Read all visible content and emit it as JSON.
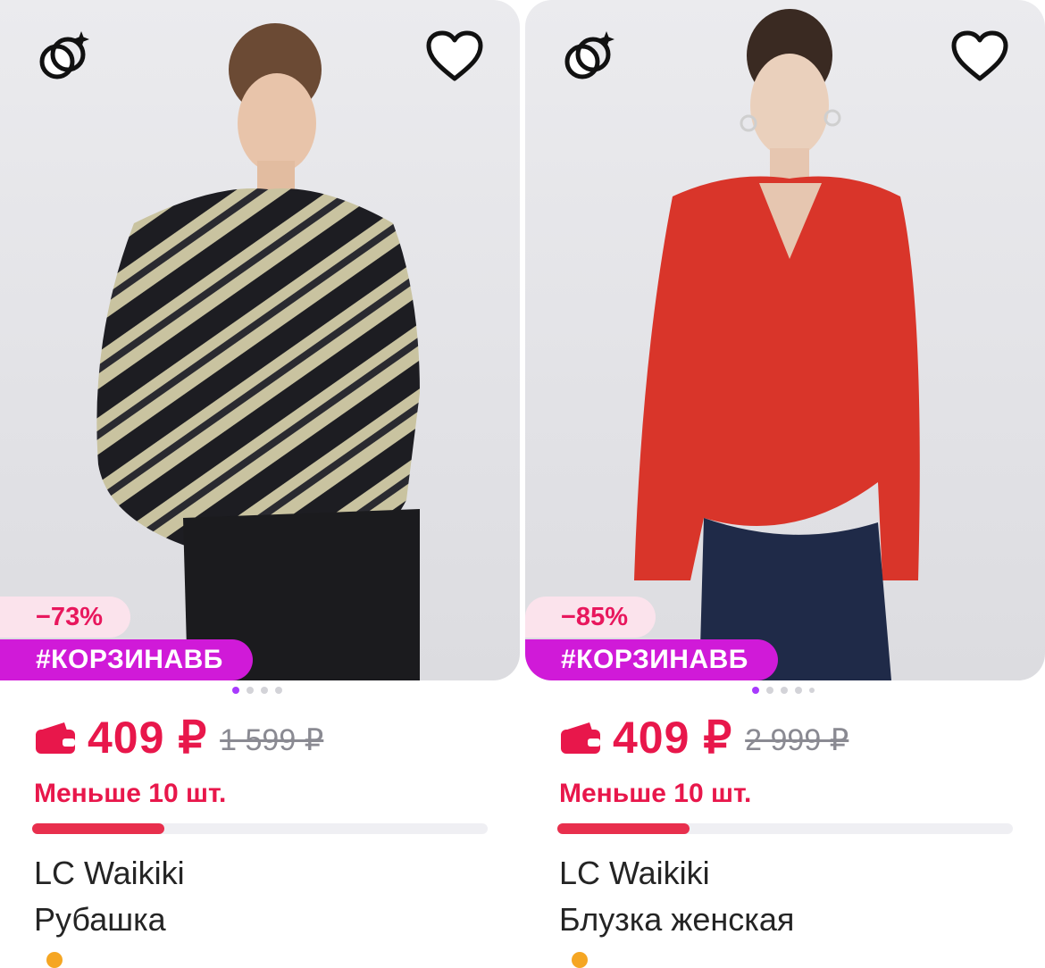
{
  "products": [
    {
      "discount": "−73%",
      "promo_tag": "#КОРЗИНАВБ",
      "price": "409 ₽",
      "old_price": "1 599 ₽",
      "stock_text": "Меньше 10 шт.",
      "stock_level_fraction": 0.29,
      "brand": "LC Waikiki",
      "title": "Рубашка",
      "photo_slides": 4,
      "active_slide": 1
    },
    {
      "discount": "−85%",
      "promo_tag": "#КОРЗИНАВБ",
      "price": "409 ₽",
      "old_price": "2 999 ₽",
      "stock_text": "Меньше 10 шт.",
      "stock_level_fraction": 0.29,
      "brand": "LC Waikiki",
      "title": "Блузка женская",
      "photo_slides": 5,
      "active_slide": 1
    }
  ],
  "icons": {
    "compare": "rings-sparkle-icon",
    "favorite": "heart-outline-icon",
    "wallet": "wallet-icon"
  },
  "colors": {
    "price": "#e8174b",
    "promo": "#d01ad8",
    "discount_bg": "#fbe3ec",
    "active_dot": "#a73afd"
  }
}
